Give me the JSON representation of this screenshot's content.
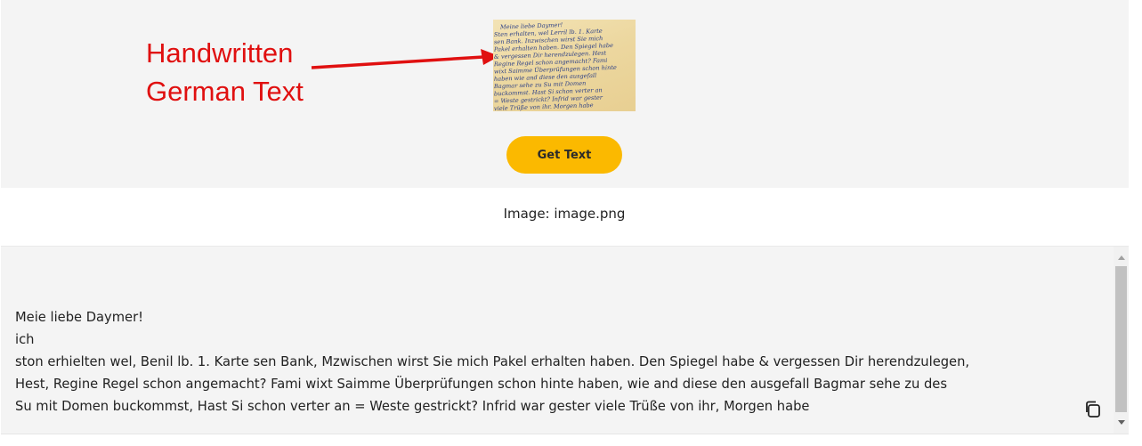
{
  "annotation": {
    "text": "Handwritten\nGerman Text",
    "color": "#e01010"
  },
  "thumbnail": {
    "lines": [
      "Meine liebe Daymer!",
      "Sten erhalten, wel Lerril lb. 1. Karte",
      "sen Bank. Inzwischen wirst Sie mich",
      "Pakel erhalten haben. Den Spiegel habe",
      "& vergessen Dir herendzulegen. Hest",
      "Regine Regel schon angemacht? Fami",
      "wixt Saimme Überprüfungen schon hinte",
      "haben wie and diese den ausgefall",
      "Bagmar sehe zu Su mit Domen",
      "buckommst. Hast Si schon verter an",
      "= Weste gestrickt? Infrid war gester",
      "viele Trüße von ihr. Morgen habe"
    ]
  },
  "actions": {
    "get_text_label": "Get Text",
    "accent_color": "#fbb900"
  },
  "caption": "Image: image.png",
  "ocr_output": {
    "text": "Meie liebe Daymer!\nich\nston erhielten wel, Benil lb. 1. Karte sen Bank, Mzwischen wirst Sie mich Pakel erhalten haben. Den Spiegel habe & vergessen Dir herendzulegen,\nHest, Regine Regel schon angemacht? Fami wixt Saimme Überprüfungen schon hinte haben, wie and diese den ausgefall Bagmar sehe zu des\nSu mit Domen buckommst, Hast Si schon verter an = Weste gestrickt? Infrid war gester viele Trüße von ihr, Morgen habe"
  },
  "icons": {
    "copy": "copy-icon",
    "arrow": "annotation-arrow"
  }
}
